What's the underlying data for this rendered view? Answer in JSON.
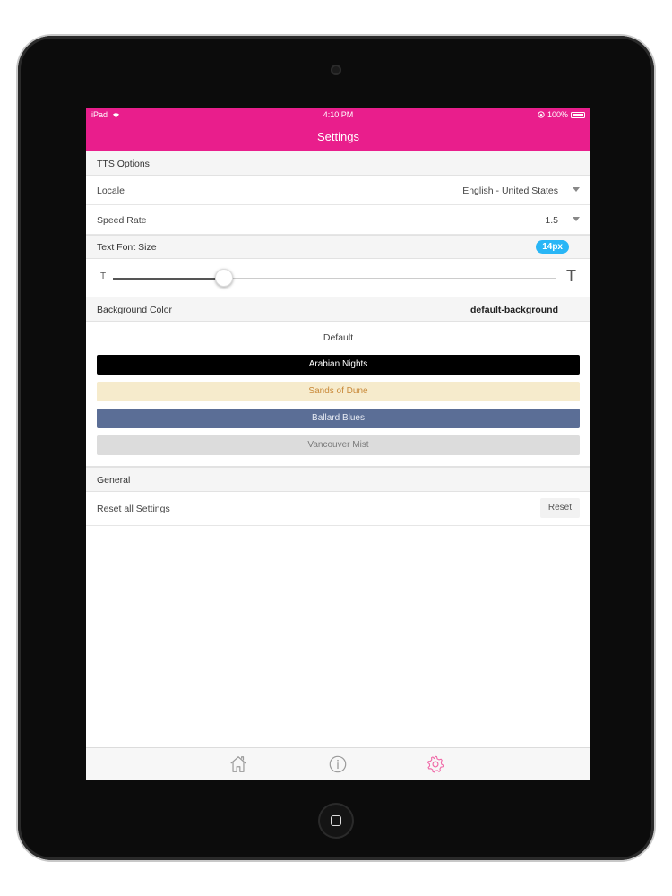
{
  "status_bar": {
    "device": "iPad",
    "time": "4:10 PM",
    "battery": "100%"
  },
  "nav": {
    "title": "Settings"
  },
  "tts_section": {
    "title": "TTS Options"
  },
  "locale": {
    "label": "Locale",
    "value": "English - United States"
  },
  "speed": {
    "label": "Speed Rate",
    "value": "1.5"
  },
  "font_size": {
    "title": "Text Font Size",
    "badge": "14px",
    "small_t": "T",
    "big_t": "T",
    "slider_level": 0.25
  },
  "background": {
    "title": "Background Color",
    "current": "default-background",
    "options": [
      {
        "label": "Default",
        "bg": "#ffffff",
        "fg": "#444444"
      },
      {
        "label": "Arabian Nights",
        "bg": "#000000",
        "fg": "#ffffff"
      },
      {
        "label": "Sands of Dune",
        "bg": "#f6ebcc",
        "fg": "#c98a3a"
      },
      {
        "label": "Ballard Blues",
        "bg": "#5b6e96",
        "fg": "#e8ecf4"
      },
      {
        "label": "Vancouver Mist",
        "bg": "#dcdcdc",
        "fg": "#7a7a7a"
      }
    ]
  },
  "general": {
    "title": "General",
    "reset_label": "Reset all Settings",
    "reset_button": "Reset"
  },
  "tabbar": {
    "items": [
      "home-icon",
      "info-icon",
      "gear-icon"
    ],
    "active_color": "#f06aa8",
    "inactive_color": "#9a9a9a"
  },
  "colors": {
    "accent": "#e91e8c",
    "badge": "#29b6f6"
  }
}
